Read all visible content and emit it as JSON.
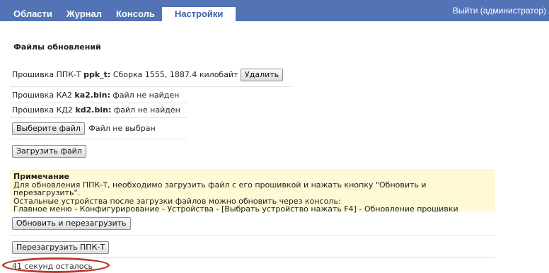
{
  "nav": {
    "tabs": [
      {
        "label": "Области"
      },
      {
        "label": "Журнал"
      },
      {
        "label": "Консоль"
      },
      {
        "label": "Настройки"
      }
    ],
    "logout_label": "Выйти (администратор)"
  },
  "section": {
    "title": "Файлы обновлений"
  },
  "firmware": [
    {
      "label": "Прошивка ППК-Т",
      "file": "ppk_t:",
      "status": "Сборка 1555, 1887.4 килобайт"
    },
    {
      "label": "Прошивка КА2",
      "file": "ka2.bin:",
      "status": "файл не найден"
    },
    {
      "label": "Прошивка КД2",
      "file": "kd2.bin:",
      "status": "файл не найден"
    }
  ],
  "buttons": {
    "delete": "Удалить",
    "choose_file": "Выберите файл",
    "upload": "Загрузить файл",
    "update_reboot": "Обновить и перезагрузить",
    "reboot": "Перезагрузить ППК-Т"
  },
  "file_input": {
    "status": "Файл не выбран"
  },
  "note": {
    "title": "Примечание",
    "lines": [
      "Для обновления ППК-Т, необходимо загрузить файл с его прошивкой и нажать кнопку \"Обновить и перезагрузить\".",
      "Остальные устройства после загрузки файлов можно обновить через консоль:",
      "Главное меню - Конфигурирование - Устройства - [Выбрать устройство нажать F4] - Обновление прошивки"
    ]
  },
  "countdown": "41 секунд осталось",
  "colors": {
    "nav_bg": "#5273b5",
    "note_bg": "#fff9d6",
    "highlight": "#c0392b"
  }
}
